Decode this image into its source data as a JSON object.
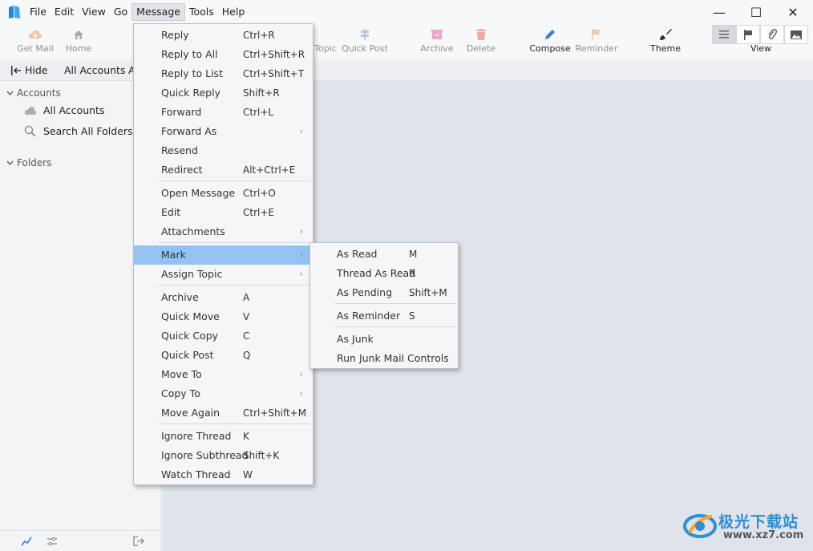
{
  "menubar": {
    "items": [
      "File",
      "Edit",
      "View",
      "Go",
      "Message",
      "Tools",
      "Help"
    ]
  },
  "window": {
    "minimize": "—",
    "maximize": "☐",
    "close": "✕"
  },
  "toolbar": {
    "get_mail": "Get Mail",
    "home": "Home",
    "topic": "Topic",
    "quick_post": "Quick Post",
    "archive": "Archive",
    "delete": "Delete",
    "compose": "Compose",
    "reminder": "Reminder",
    "theme": "Theme",
    "view": "View",
    "accent": "#3b7fd6"
  },
  "tabrow": {
    "hide": "Hide",
    "all_accounts": "All Accounts",
    "overflow": "A"
  },
  "sidebar": {
    "accounts_header": "Accounts",
    "all_accounts": "All Accounts",
    "search_all_folders": "Search All Folders",
    "folders_header": "Folders"
  },
  "message_menu": [
    {
      "label": "Reply",
      "shortcut": "Ctrl+R"
    },
    {
      "label": "Reply to All",
      "shortcut": "Ctrl+Shift+R"
    },
    {
      "label": "Reply to List",
      "shortcut": "Ctrl+Shift+T"
    },
    {
      "label": "Quick Reply",
      "shortcut": "Shift+R"
    },
    {
      "label": "Forward",
      "shortcut": "Ctrl+L"
    },
    {
      "label": "Forward As",
      "shortcut": "",
      "submenu": true
    },
    {
      "label": "Resend",
      "shortcut": ""
    },
    {
      "label": "Redirect",
      "shortcut": "Alt+Ctrl+E"
    },
    {
      "label": "Open Message",
      "shortcut": "Ctrl+O"
    },
    {
      "label": "Edit",
      "shortcut": "Ctrl+E"
    },
    {
      "label": "Attachments",
      "shortcut": "",
      "submenu": true
    },
    {
      "label": "Mark",
      "shortcut": "",
      "submenu": true,
      "highlighted": true
    },
    {
      "label": "Assign Topic",
      "shortcut": "",
      "submenu": true
    },
    {
      "label": "Archive",
      "shortcut": "A"
    },
    {
      "label": "Quick Move",
      "shortcut": "V"
    },
    {
      "label": "Quick Copy",
      "shortcut": "C"
    },
    {
      "label": "Quick Post",
      "shortcut": "Q"
    },
    {
      "label": "Move To",
      "shortcut": "",
      "submenu": true
    },
    {
      "label": "Copy To",
      "shortcut": "",
      "submenu": true
    },
    {
      "label": "Move Again",
      "shortcut": "Ctrl+Shift+M"
    },
    {
      "label": "Ignore Thread",
      "shortcut": "K"
    },
    {
      "label": "Ignore Subthread",
      "shortcut": "Shift+K"
    },
    {
      "label": "Watch Thread",
      "shortcut": "W"
    }
  ],
  "mark_submenu": [
    {
      "label": "As Read",
      "shortcut": "M"
    },
    {
      "label": "Thread As Read",
      "shortcut": "R"
    },
    {
      "label": "As Pending",
      "shortcut": "Shift+M"
    },
    {
      "label": "As Reminder",
      "shortcut": "S"
    },
    {
      "label": "As Junk",
      "shortcut": ""
    },
    {
      "label": "Run Junk Mail Controls",
      "shortcut": ""
    }
  ],
  "watermark": {
    "brand": "极光下载站",
    "url": "www.xz7.com"
  }
}
